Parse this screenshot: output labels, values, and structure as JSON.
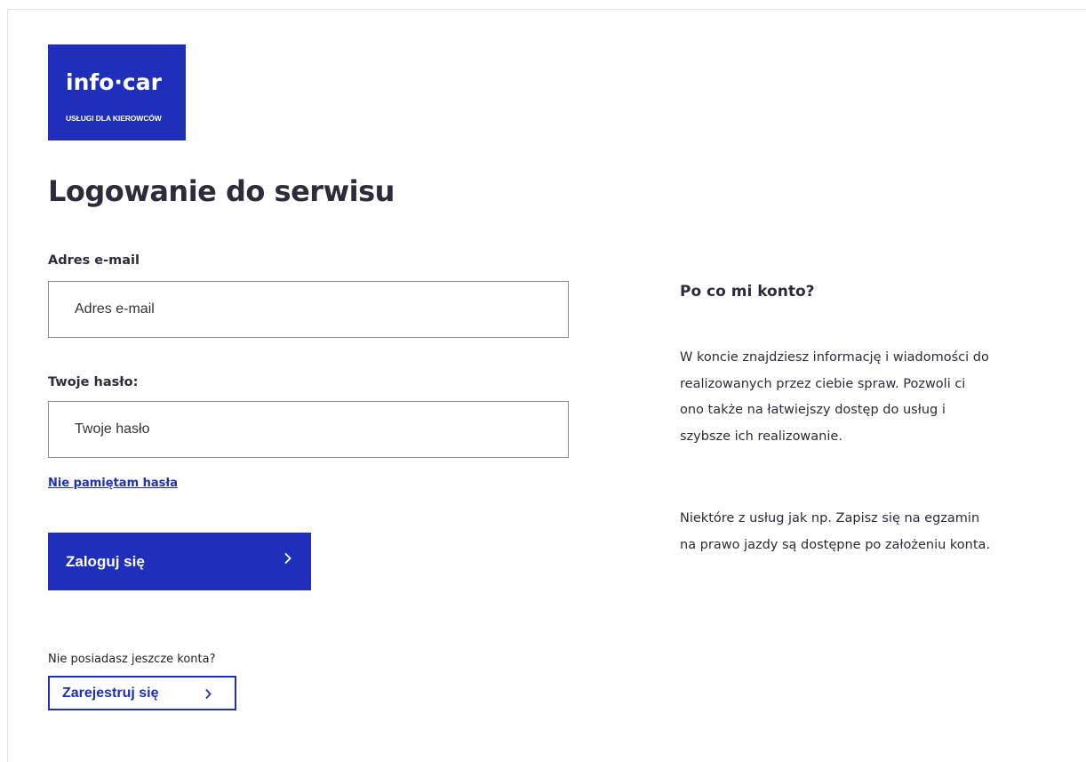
{
  "brand": {
    "logo_text": "info·car",
    "logo_subtitle": "USŁUGI DLA KIEROWCÓW",
    "color": "#1f2fba"
  },
  "login": {
    "title": "Logowanie do serwisu",
    "email_label": "Adres e-mail",
    "email_placeholder": "Adres e-mail",
    "email_value": "",
    "password_label": "Twoje hasło:",
    "password_placeholder": "Twoje hasło",
    "password_value": "",
    "forgot_link": "Nie pamiętam hasła",
    "submit_label": "Zaloguj się",
    "no_account_text": "Nie posiadasz jeszcze konta?",
    "register_label": "Zarejestruj się"
  },
  "aside": {
    "title": "Po co mi konto?",
    "paragraph_1": "W koncie znajdziesz informację i wiadomości do realizowanych przez ciebie spraw. Pozwoli ci ono także na łatwiejszy dostęp do usług i szybsze ich realizowanie.",
    "paragraph_2": "Niektóre z usług jak np. Zapisz się na egzamin na prawo jazdy są dostępne po założeniu konta."
  },
  "icons": {
    "submit_icon": "chevron-right-icon",
    "register_icon": "chevron-right-icon"
  }
}
